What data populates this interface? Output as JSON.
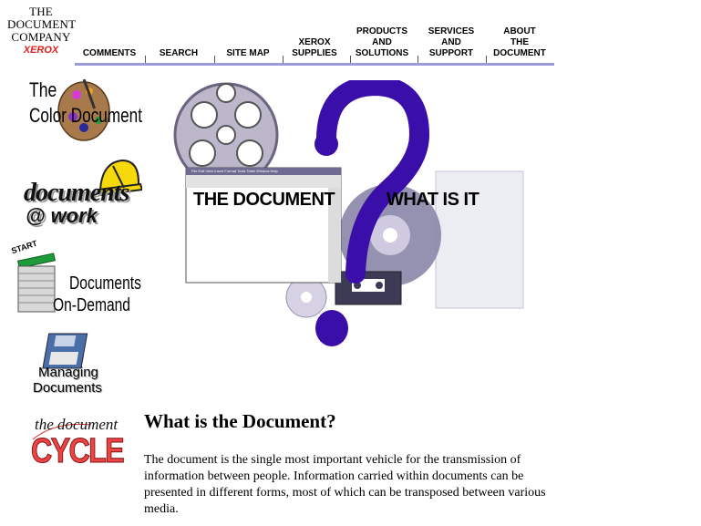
{
  "header": {
    "logo": {
      "lines": [
        "THE",
        "DOCUMENT",
        "COMPANY"
      ],
      "brand": "XEROX",
      "brand_color": "#e01e1e"
    },
    "nav": [
      {
        "label": "COMMENTS"
      },
      {
        "label": "SEARCH"
      },
      {
        "label": "SITE MAP"
      },
      {
        "label": "XEROX\nSUPPLIES"
      },
      {
        "label": "PRODUCTS\nAND\nSOLUTIONS"
      },
      {
        "label": "SERVICES\nAND\nSUPPORT"
      },
      {
        "label": "ABOUT\nTHE\nDOCUMENT"
      }
    ],
    "nav_bar_color": "#9c9ad8"
  },
  "sidebar": [
    {
      "label_a": "The",
      "label_b": "Color Document",
      "icon": "paint-palette-icon"
    },
    {
      "label_a": "documents",
      "label_b": "@ work",
      "icon": "hard-hat-icon"
    },
    {
      "label_a": "Documents",
      "label_b": "On-Demand",
      "start": "START",
      "icon": "paper-stack-icon"
    },
    {
      "label_a": "Managing",
      "label_b": "Documents",
      "icon": "floppy-disk-icon"
    },
    {
      "label_a": "the document",
      "label_b": "CYCLE",
      "icon": "cycle-logo-icon"
    }
  ],
  "hero": {
    "label_left": "THE DOCUMENT",
    "label_right": "WHAT IS IT",
    "window_menu": "File  Edit  View  Insert  Format  Tools  Table  Window  Help",
    "accent_color": "#3a0ea8"
  },
  "content": {
    "title": "What is the Document?",
    "body": "The document is the single most important vehicle for the transmission of information between people. Information carried within documents can be presented in different forms, most of which can be transposed between various media."
  }
}
